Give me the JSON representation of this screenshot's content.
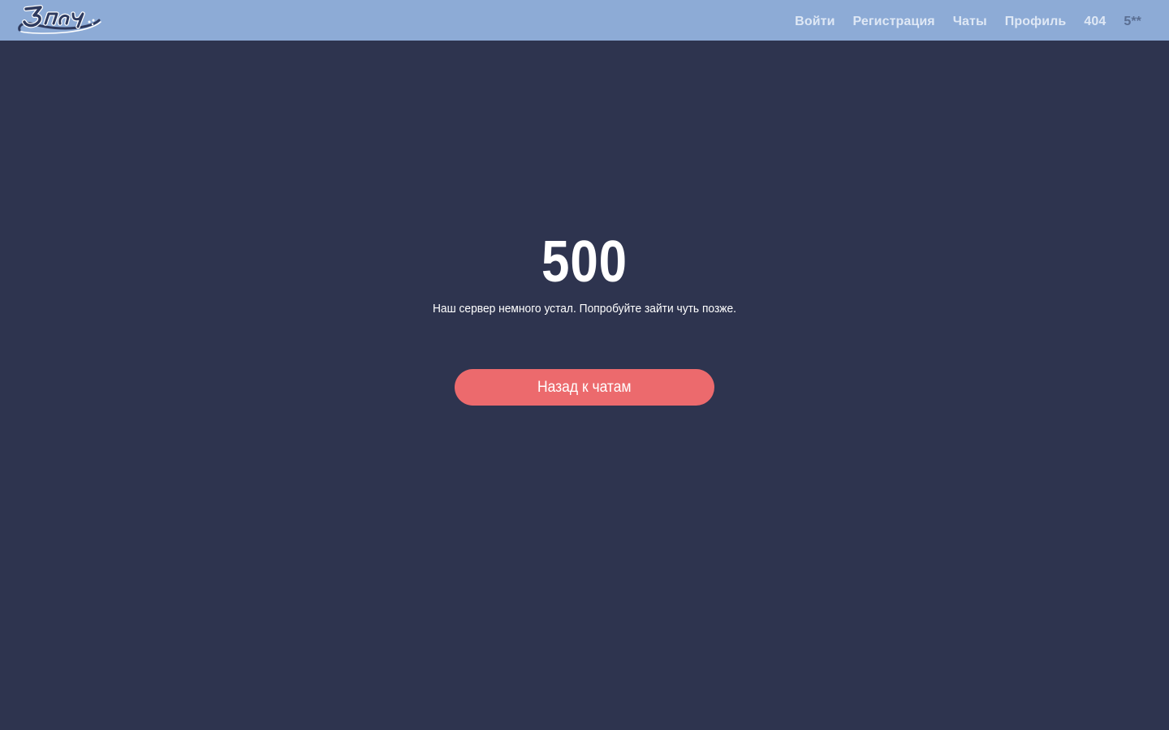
{
  "header": {
    "logo_text": "2pach",
    "nav": [
      {
        "label": "Войти",
        "active": false
      },
      {
        "label": "Регистрация",
        "active": false
      },
      {
        "label": "Чаты",
        "active": false
      },
      {
        "label": "Профиль",
        "active": false
      },
      {
        "label": "404",
        "active": false
      },
      {
        "label": "5**",
        "active": true
      }
    ]
  },
  "error": {
    "code": "500",
    "message": "Наш сервер немного устал. Попробуйте зайти чуть позже.",
    "button_label": "Назад к чатам"
  },
  "colors": {
    "background": "#2e344f",
    "header": "#8dabd6",
    "nav_text": "#dfe8f5",
    "nav_active": "#5a6e92",
    "button": "#ec6a6d"
  }
}
